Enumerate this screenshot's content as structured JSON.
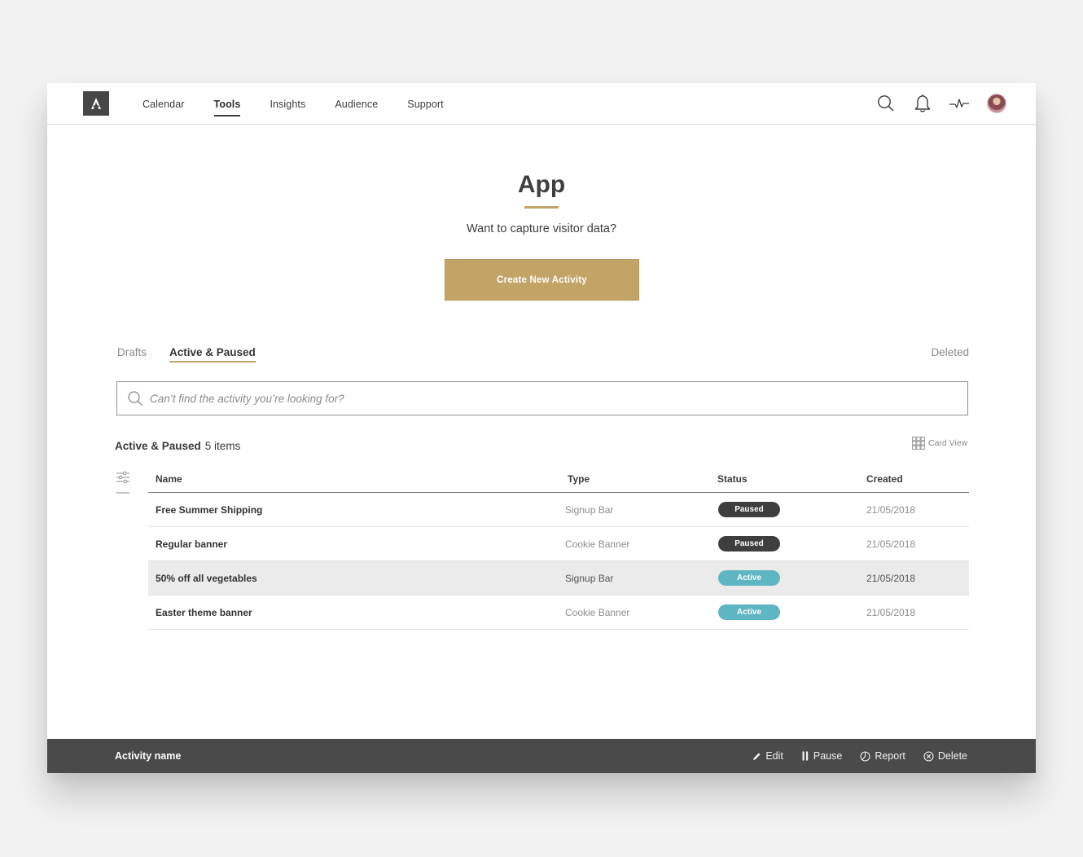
{
  "nav": {
    "logo_letter": "A",
    "links": [
      "Calendar",
      "Tools",
      "Insights",
      "Audience",
      "Support"
    ],
    "active_link": "Tools",
    "icons": [
      "search-icon",
      "bell-icon",
      "activity-icon",
      "avatar"
    ]
  },
  "hero": {
    "title": "App",
    "subtitle": "Want to capture visitor data?",
    "button_label": "Create New Activity"
  },
  "tabs": {
    "drafts": "Drafts",
    "active_paused": "Active & Paused",
    "deleted": "Deleted",
    "active_tab": "Active & Paused"
  },
  "search": {
    "placeholder": "Can’t find the activity you’re looking for?"
  },
  "list": {
    "title": "Active & Paused",
    "count": "5 items",
    "card_view_label": "Card View",
    "columns": {
      "name": "Name",
      "type": "Type",
      "status": "Status",
      "created": "Created"
    },
    "rows": [
      {
        "name": "Free Summer Shipping",
        "type": "Signup Bar",
        "status": "Paused",
        "created": "21/05/2018"
      },
      {
        "name": "Regular banner",
        "type": "Cookie Banner",
        "status": "Paused",
        "created": "21/05/2018"
      },
      {
        "name": "50% off all vegetables",
        "type": "Signup Bar",
        "status": "Active",
        "created": "21/05/2018"
      },
      {
        "name": "Easter theme banner",
        "type": "Cookie Banner",
        "status": "Active",
        "created": "21/05/2018"
      }
    ]
  },
  "bottom_bar": {
    "title": "Activity name",
    "actions": {
      "edit": "Edit",
      "pause": "Pause",
      "report": "Report",
      "delete": "Delete"
    }
  },
  "colors": {
    "accent_gold": "#c2a466",
    "dark": "#4a4a4a",
    "paused_badge": "#3e3e3e",
    "active_badge": "#5fb6c3"
  }
}
